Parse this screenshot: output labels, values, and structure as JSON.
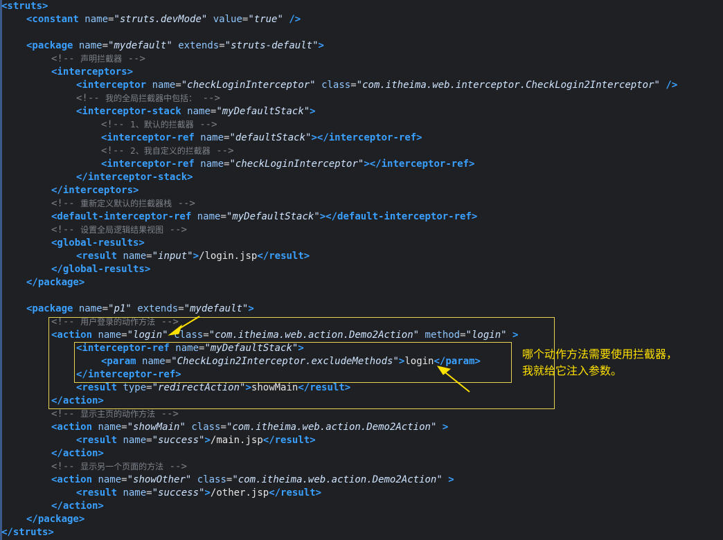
{
  "code": {
    "lines": [
      {
        "indent": 0,
        "parts": [
          [
            "tag",
            "<struts>"
          ]
        ]
      },
      {
        "indent": 1,
        "parts": [
          [
            "tag",
            "<constant"
          ],
          [
            "sp",
            " "
          ],
          [
            "attr",
            "name"
          ],
          [
            "eq",
            "="
          ],
          [
            "val",
            "\"struts.devMode\""
          ],
          [
            "sp",
            " "
          ],
          [
            "attr",
            "value"
          ],
          [
            "eq",
            "="
          ],
          [
            "val",
            "\"true\""
          ],
          [
            "sp",
            " "
          ],
          [
            "tag",
            "/>"
          ]
        ]
      },
      {
        "indent": 0,
        "parts": []
      },
      {
        "indent": 1,
        "parts": [
          [
            "tag",
            "<package"
          ],
          [
            "sp",
            " "
          ],
          [
            "attr",
            "name"
          ],
          [
            "eq",
            "="
          ],
          [
            "val",
            "\"mydefault\""
          ],
          [
            "sp",
            " "
          ],
          [
            "attr",
            "extends"
          ],
          [
            "eq",
            "="
          ],
          [
            "val",
            "\"struts-default\""
          ],
          [
            "tag",
            ">"
          ]
        ]
      },
      {
        "indent": 2,
        "parts": [
          [
            "cm",
            "<!-- "
          ],
          [
            "ct",
            "声明拦截器"
          ],
          [
            "cm",
            " -->"
          ]
        ]
      },
      {
        "indent": 2,
        "parts": [
          [
            "tag",
            "<interceptors>"
          ]
        ]
      },
      {
        "indent": 3,
        "parts": [
          [
            "tag",
            "<interceptor"
          ],
          [
            "sp",
            " "
          ],
          [
            "attr",
            "name"
          ],
          [
            "eq",
            "="
          ],
          [
            "val",
            "\"checkLoginInterceptor\""
          ],
          [
            "sp",
            " "
          ],
          [
            "attr",
            "class"
          ],
          [
            "eq",
            "="
          ],
          [
            "val",
            "\"com.itheima.web.interceptor.CheckLogin2Interceptor\""
          ],
          [
            "sp",
            " "
          ],
          [
            "tag",
            "/>"
          ]
        ]
      },
      {
        "indent": 3,
        "parts": [
          [
            "cm",
            "<!-- "
          ],
          [
            "ct",
            "我的全局拦截器中包括："
          ],
          [
            "cm",
            " -->"
          ]
        ]
      },
      {
        "indent": 3,
        "parts": [
          [
            "tag",
            "<interceptor-stack"
          ],
          [
            "sp",
            " "
          ],
          [
            "attr",
            "name"
          ],
          [
            "eq",
            "="
          ],
          [
            "val",
            "\"myDefaultStack\""
          ],
          [
            "tag",
            ">"
          ]
        ]
      },
      {
        "indent": 4,
        "parts": [
          [
            "cm",
            "<!-- "
          ],
          [
            "ct",
            "1、默认的拦截器"
          ],
          [
            "cm",
            " -->"
          ]
        ]
      },
      {
        "indent": 4,
        "parts": [
          [
            "tag",
            "<interceptor-ref"
          ],
          [
            "sp",
            " "
          ],
          [
            "attr",
            "name"
          ],
          [
            "eq",
            "="
          ],
          [
            "val",
            "\"defaultStack\""
          ],
          [
            "tag",
            "></interceptor-ref>"
          ]
        ]
      },
      {
        "indent": 4,
        "parts": [
          [
            "cm",
            "<!-- "
          ],
          [
            "ct",
            "2、我自定义的拦截器"
          ],
          [
            "cm",
            " -->"
          ]
        ]
      },
      {
        "indent": 4,
        "parts": [
          [
            "tag",
            "<interceptor-ref"
          ],
          [
            "sp",
            " "
          ],
          [
            "attr",
            "name"
          ],
          [
            "eq",
            "="
          ],
          [
            "val",
            "\"checkLoginInterceptor\""
          ],
          [
            "tag",
            "></interceptor-ref>"
          ]
        ]
      },
      {
        "indent": 3,
        "parts": [
          [
            "tag",
            "</interceptor-stack>"
          ]
        ]
      },
      {
        "indent": 2,
        "parts": [
          [
            "tag",
            "</interceptors>"
          ]
        ]
      },
      {
        "indent": 2,
        "parts": [
          [
            "cm",
            "<!-- "
          ],
          [
            "ct",
            "重新定义默认的拦截器栈"
          ],
          [
            "cm",
            " -->"
          ]
        ]
      },
      {
        "indent": 2,
        "parts": [
          [
            "tag",
            "<default-interceptor-ref"
          ],
          [
            "sp",
            " "
          ],
          [
            "attr",
            "name"
          ],
          [
            "eq",
            "="
          ],
          [
            "val",
            "\"myDefaultStack\""
          ],
          [
            "tag",
            "></default-interceptor-ref>"
          ]
        ]
      },
      {
        "indent": 2,
        "parts": [
          [
            "cm",
            "<!-- "
          ],
          [
            "ct",
            "设置全局逻辑结果视图"
          ],
          [
            "cm",
            " -->"
          ]
        ]
      },
      {
        "indent": 2,
        "parts": [
          [
            "tag",
            "<global-results>"
          ]
        ]
      },
      {
        "indent": 3,
        "parts": [
          [
            "tag",
            "<result"
          ],
          [
            "sp",
            " "
          ],
          [
            "attr",
            "name"
          ],
          [
            "eq",
            "="
          ],
          [
            "val",
            "\"input\""
          ],
          [
            "tag",
            ">"
          ],
          [
            "tx",
            "/login.jsp"
          ],
          [
            "tag",
            "</result>"
          ]
        ]
      },
      {
        "indent": 2,
        "parts": [
          [
            "tag",
            "</global-results>"
          ]
        ]
      },
      {
        "indent": 1,
        "parts": [
          [
            "tag",
            "</package>"
          ]
        ]
      },
      {
        "indent": 0,
        "parts": []
      },
      {
        "indent": 1,
        "parts": [
          [
            "tag",
            "<package"
          ],
          [
            "sp",
            " "
          ],
          [
            "attr",
            "name"
          ],
          [
            "eq",
            "="
          ],
          [
            "val",
            "\"p1\""
          ],
          [
            "sp",
            " "
          ],
          [
            "attr",
            "extends"
          ],
          [
            "eq",
            "="
          ],
          [
            "val",
            "\"mydefault\""
          ],
          [
            "tag",
            ">"
          ]
        ]
      },
      {
        "indent": 2,
        "parts": [
          [
            "cm",
            "<!-- "
          ],
          [
            "ct",
            "用户登录的动作方法"
          ],
          [
            "cm",
            " -->"
          ]
        ]
      },
      {
        "indent": 2,
        "parts": [
          [
            "tag",
            "<action"
          ],
          [
            "sp",
            " "
          ],
          [
            "attr",
            "name"
          ],
          [
            "eq",
            "="
          ],
          [
            "val",
            "\"login\""
          ],
          [
            "sp",
            " "
          ],
          [
            "attr",
            "class"
          ],
          [
            "eq",
            "="
          ],
          [
            "val",
            "\"com.itheima.web.action.Demo2Action\""
          ],
          [
            "sp",
            " "
          ],
          [
            "attr",
            "method"
          ],
          [
            "eq",
            "="
          ],
          [
            "val",
            "\"login\""
          ],
          [
            "sp",
            " "
          ],
          [
            "tag",
            ">"
          ]
        ]
      },
      {
        "indent": 3,
        "parts": [
          [
            "tag",
            "<interceptor-ref"
          ],
          [
            "sp",
            " "
          ],
          [
            "attr",
            "name"
          ],
          [
            "eq",
            "="
          ],
          [
            "val",
            "\"myDefaultStack\""
          ],
          [
            "tag",
            ">"
          ]
        ]
      },
      {
        "indent": 4,
        "parts": [
          [
            "tag",
            "<param"
          ],
          [
            "sp",
            " "
          ],
          [
            "attr",
            "name"
          ],
          [
            "eq",
            "="
          ],
          [
            "val",
            "\"CheckLogin2Interceptor.excludeMethods\""
          ],
          [
            "tag",
            ">"
          ],
          [
            "tx",
            "login"
          ],
          [
            "tag",
            "</param>"
          ]
        ]
      },
      {
        "indent": 3,
        "parts": [
          [
            "tag",
            "</interceptor-ref>"
          ]
        ]
      },
      {
        "indent": 3,
        "parts": [
          [
            "tag",
            "<result"
          ],
          [
            "sp",
            " "
          ],
          [
            "attr",
            "type"
          ],
          [
            "eq",
            "="
          ],
          [
            "val",
            "\"redirectAction\""
          ],
          [
            "tag",
            ">"
          ],
          [
            "tx",
            "showMain"
          ],
          [
            "tag",
            "</result>"
          ]
        ]
      },
      {
        "indent": 2,
        "parts": [
          [
            "tag",
            "</action>"
          ]
        ]
      },
      {
        "indent": 2,
        "parts": [
          [
            "cm",
            "<!-- "
          ],
          [
            "ct",
            "显示主页的动作方法"
          ],
          [
            "cm",
            " -->"
          ]
        ]
      },
      {
        "indent": 2,
        "parts": [
          [
            "tag",
            "<action"
          ],
          [
            "sp",
            " "
          ],
          [
            "attr",
            "name"
          ],
          [
            "eq",
            "="
          ],
          [
            "val",
            "\"showMain\""
          ],
          [
            "sp",
            " "
          ],
          [
            "attr",
            "class"
          ],
          [
            "eq",
            "="
          ],
          [
            "val",
            "\"com.itheima.web.action.Demo2Action\""
          ],
          [
            "sp",
            " "
          ],
          [
            "tag",
            ">"
          ]
        ]
      },
      {
        "indent": 3,
        "parts": [
          [
            "tag",
            "<result"
          ],
          [
            "sp",
            " "
          ],
          [
            "attr",
            "name"
          ],
          [
            "eq",
            "="
          ],
          [
            "val",
            "\"success\""
          ],
          [
            "tag",
            ">"
          ],
          [
            "tx",
            "/main.jsp"
          ],
          [
            "tag",
            "</result>"
          ]
        ]
      },
      {
        "indent": 2,
        "parts": [
          [
            "tag",
            "</action>"
          ]
        ]
      },
      {
        "indent": 2,
        "parts": [
          [
            "cm",
            "<!-- "
          ],
          [
            "ct",
            "显示另一个页面的方法"
          ],
          [
            "cm",
            " -->"
          ]
        ]
      },
      {
        "indent": 2,
        "parts": [
          [
            "tag",
            "<action"
          ],
          [
            "sp",
            " "
          ],
          [
            "attr",
            "name"
          ],
          [
            "eq",
            "="
          ],
          [
            "val",
            "\"showOther\""
          ],
          [
            "sp",
            " "
          ],
          [
            "attr",
            "class"
          ],
          [
            "eq",
            "="
          ],
          [
            "val",
            "\"com.itheima.web.action.Demo2Action\""
          ],
          [
            "sp",
            " "
          ],
          [
            "tag",
            ">"
          ]
        ]
      },
      {
        "indent": 3,
        "parts": [
          [
            "tag",
            "<result"
          ],
          [
            "sp",
            " "
          ],
          [
            "attr",
            "name"
          ],
          [
            "eq",
            "="
          ],
          [
            "val",
            "\"success\""
          ],
          [
            "tag",
            ">"
          ],
          [
            "tx",
            "/other.jsp"
          ],
          [
            "tag",
            "</result>"
          ]
        ]
      },
      {
        "indent": 2,
        "parts": [
          [
            "tag",
            "</action>"
          ]
        ]
      },
      {
        "indent": 1,
        "parts": [
          [
            "tag",
            "</package>"
          ]
        ]
      },
      {
        "indent": 0,
        "parts": [
          [
            "tag",
            "</struts>"
          ]
        ]
      }
    ]
  },
  "annotation": {
    "line1": "哪个动作方法需要使用拦截器，",
    "line2": "我就给它注入参数。"
  },
  "colors": {
    "highlight": "#e8d44d",
    "annotation": "#ffe100",
    "tag": "#3aa0ff",
    "value": "#cfe4ff"
  }
}
